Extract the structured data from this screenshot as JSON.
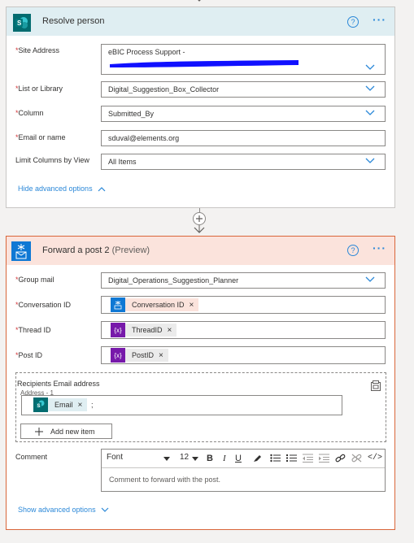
{
  "colors": {
    "accent": "#2b88d8",
    "required": "#d13438",
    "sharepoint": "#036c70",
    "outlook": "#0f78d4",
    "variable": "#7719aa",
    "card2_border": "#d9663a"
  },
  "card1": {
    "title": "Resolve person",
    "icon": "sharepoint-icon",
    "fields": {
      "site_address": {
        "label": "Site Address",
        "value": "eBIC Process Support -"
      },
      "list": {
        "label": "List or Library",
        "value": "Digital_Suggestion_Box_Collector"
      },
      "column": {
        "label": "Column",
        "value": "Submitted_By"
      },
      "email": {
        "label": "Email or name",
        "value": "sduval@elements.org"
      },
      "limit_view": {
        "label": "Limit Columns by View",
        "value": "All Items"
      }
    },
    "advanced_link": "Hide advanced options"
  },
  "card2": {
    "title": "Forward a post 2",
    "title_suffix": "(Preview)",
    "icon": "groups-mail-icon",
    "fields": {
      "group_mail": {
        "label": "Group mail",
        "value": "Digital_Operations_Suggestion_Planner"
      },
      "conversation_id": {
        "label": "Conversation ID",
        "token": "Conversation ID"
      },
      "thread_id": {
        "label": "Thread ID",
        "token": "ThreadID"
      },
      "post_id": {
        "label": "Post ID",
        "token": "PostID"
      }
    },
    "recipients": {
      "label": "Recipients Email address",
      "sublabel": "Address - 1",
      "token": "Email",
      "trailing": ";",
      "add_button": "Add new item"
    },
    "comment": {
      "label": "Comment",
      "font": "Font",
      "size": "12",
      "placeholder": "Comment to forward with the post."
    },
    "advanced_link": "Show advanced options"
  },
  "star": "*",
  "variable_symbol": "{x}"
}
